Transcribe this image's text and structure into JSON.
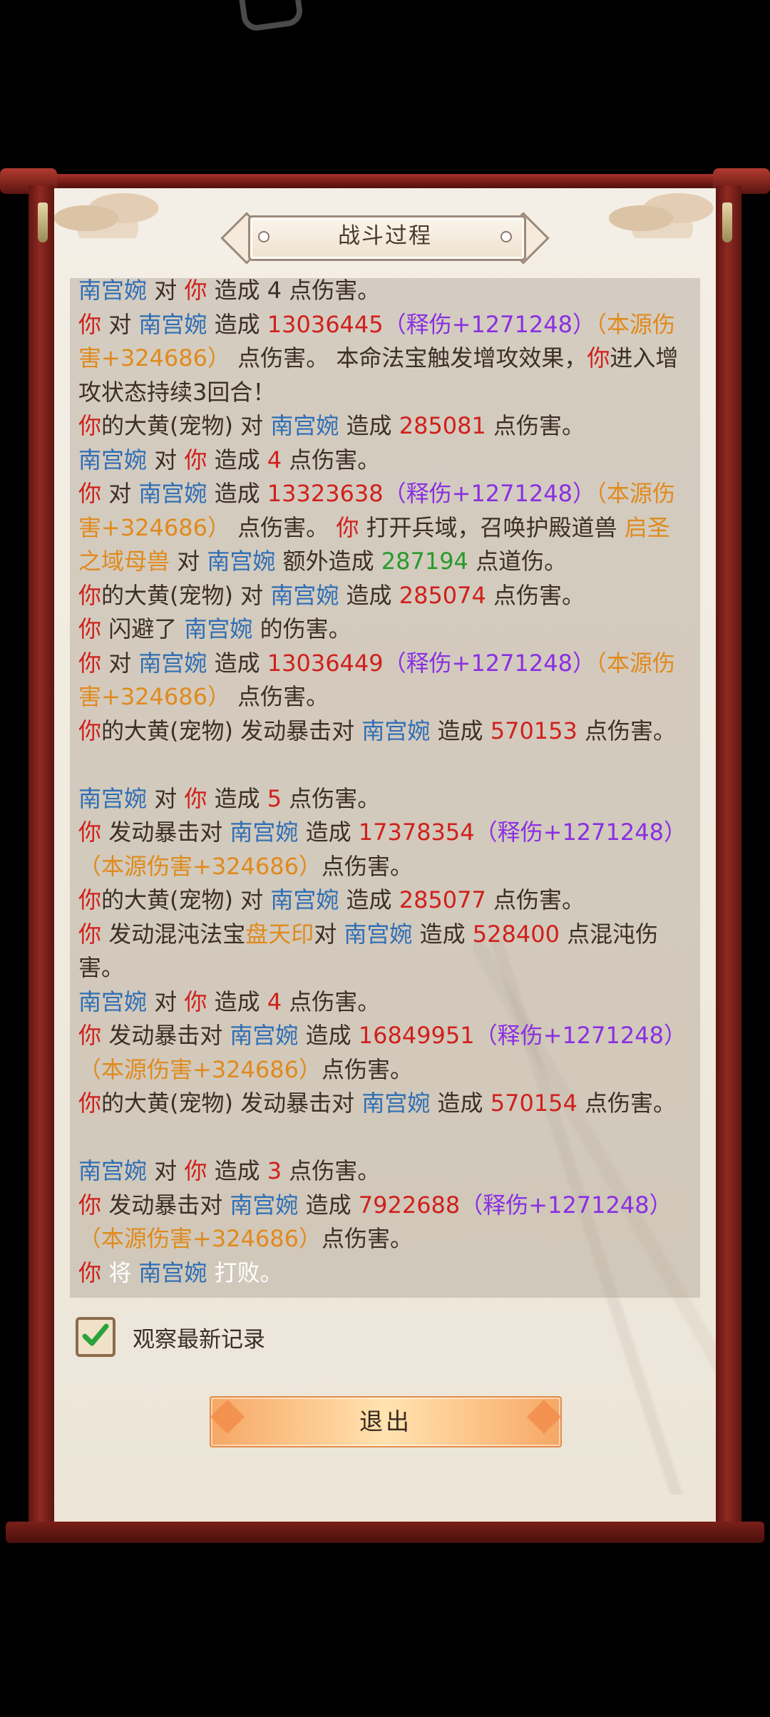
{
  "dialog": {
    "title": "战斗过程",
    "checkbox_label": "观察最新记录",
    "checkbox_checked": true,
    "exit_label": "退出"
  },
  "colors": {
    "player": "#d0201c",
    "enemy": "#2f6eb5",
    "bonus_damage": "#8a2fe2",
    "origin_damage": "#e08a1e",
    "dao_damage": "#279a2b",
    "scroll_frame": "#7a1f19"
  },
  "log": [
    {
      "segments": [
        {
          "t": "南宫婉",
          "c": "b"
        },
        {
          "t": " 对 ",
          "c": ""
        },
        {
          "t": "你",
          "c": "r"
        },
        {
          "t": " 造成 4 点伤害。",
          "c": ""
        }
      ]
    },
    {
      "segments": [
        {
          "t": "你",
          "c": "r"
        },
        {
          "t": " 对 ",
          "c": ""
        },
        {
          "t": "南宫婉",
          "c": "b"
        },
        {
          "t": " 造成 ",
          "c": ""
        },
        {
          "t": "13036445",
          "c": "r"
        },
        {
          "t": "（释伤+1271248）",
          "c": "p"
        },
        {
          "t": "（本源伤害+324686）",
          "c": "o"
        },
        {
          "t": " 点伤害。 本命法宝触发增攻效果，",
          "c": ""
        },
        {
          "t": "你",
          "c": "r"
        },
        {
          "t": "进入增攻状态持续3回合！",
          "c": ""
        }
      ]
    },
    {
      "segments": [
        {
          "t": "你",
          "c": "r"
        },
        {
          "t": "的大黄(宠物) 对 ",
          "c": ""
        },
        {
          "t": "南宫婉",
          "c": "b"
        },
        {
          "t": " 造成 ",
          "c": ""
        },
        {
          "t": "285081",
          "c": "r"
        },
        {
          "t": " 点伤害。",
          "c": ""
        }
      ]
    },
    {
      "segments": [
        {
          "t": "南宫婉",
          "c": "b"
        },
        {
          "t": " 对 ",
          "c": ""
        },
        {
          "t": "你",
          "c": "r"
        },
        {
          "t": " 造成 ",
          "c": ""
        },
        {
          "t": "4",
          "c": "r"
        },
        {
          "t": " 点伤害。",
          "c": ""
        }
      ]
    },
    {
      "segments": [
        {
          "t": "你",
          "c": "r"
        },
        {
          "t": " 对 ",
          "c": ""
        },
        {
          "t": "南宫婉",
          "c": "b"
        },
        {
          "t": " 造成 ",
          "c": ""
        },
        {
          "t": "13323638",
          "c": "r"
        },
        {
          "t": "（释伤+1271248）",
          "c": "p"
        },
        {
          "t": "（本源伤害+324686）",
          "c": "o"
        },
        {
          "t": " 点伤害。 ",
          "c": ""
        },
        {
          "t": "你",
          "c": "r"
        },
        {
          "t": " 打开兵域，召唤护殿道兽 ",
          "c": ""
        },
        {
          "t": "启圣之域母兽",
          "c": "o"
        },
        {
          "t": " 对 ",
          "c": ""
        },
        {
          "t": "南宫婉",
          "c": "b"
        },
        {
          "t": " 额外造成 ",
          "c": ""
        },
        {
          "t": "287194",
          "c": "g"
        },
        {
          "t": " 点道伤。",
          "c": ""
        }
      ]
    },
    {
      "segments": [
        {
          "t": "你",
          "c": "r"
        },
        {
          "t": "的大黄(宠物) 对 ",
          "c": ""
        },
        {
          "t": "南宫婉",
          "c": "b"
        },
        {
          "t": " 造成 ",
          "c": ""
        },
        {
          "t": "285074",
          "c": "r"
        },
        {
          "t": " 点伤害。",
          "c": ""
        }
      ]
    },
    {
      "segments": [
        {
          "t": "你",
          "c": "r"
        },
        {
          "t": " 闪避了 ",
          "c": ""
        },
        {
          "t": "南宫婉",
          "c": "b"
        },
        {
          "t": " 的伤害。",
          "c": ""
        }
      ]
    },
    {
      "segments": [
        {
          "t": "你",
          "c": "r"
        },
        {
          "t": " 对 ",
          "c": ""
        },
        {
          "t": "南宫婉",
          "c": "b"
        },
        {
          "t": " 造成 ",
          "c": ""
        },
        {
          "t": "13036449",
          "c": "r"
        },
        {
          "t": "（释伤+1271248）",
          "c": "p"
        },
        {
          "t": "（本源伤害+324686）",
          "c": "o"
        },
        {
          "t": " 点伤害。",
          "c": ""
        }
      ]
    },
    {
      "segments": [
        {
          "t": "你",
          "c": "r"
        },
        {
          "t": "的大黄(宠物) 发动暴击对 ",
          "c": ""
        },
        {
          "t": "南宫婉",
          "c": "b"
        },
        {
          "t": " 造成 ",
          "c": ""
        },
        {
          "t": "570153",
          "c": "r"
        },
        {
          "t": " 点伤害。",
          "c": ""
        }
      ]
    },
    {
      "gap": true
    },
    {
      "segments": [
        {
          "t": "南宫婉",
          "c": "b"
        },
        {
          "t": " 对 ",
          "c": ""
        },
        {
          "t": "你",
          "c": "r"
        },
        {
          "t": " 造成 ",
          "c": ""
        },
        {
          "t": "5",
          "c": "r"
        },
        {
          "t": " 点伤害。",
          "c": ""
        }
      ]
    },
    {
      "segments": [
        {
          "t": "你",
          "c": "r"
        },
        {
          "t": " 发动暴击对 ",
          "c": ""
        },
        {
          "t": "南宫婉",
          "c": "b"
        },
        {
          "t": " 造成 ",
          "c": ""
        },
        {
          "t": "17378354",
          "c": "r"
        },
        {
          "t": "（释伤+1271248）",
          "c": "p"
        },
        {
          "t": "（本源伤害+324686）",
          "c": "o"
        },
        {
          "t": "点伤害。",
          "c": ""
        }
      ]
    },
    {
      "segments": [
        {
          "t": "你",
          "c": "r"
        },
        {
          "t": "的大黄(宠物) 对 ",
          "c": ""
        },
        {
          "t": "南宫婉",
          "c": "b"
        },
        {
          "t": " 造成 ",
          "c": ""
        },
        {
          "t": "285077",
          "c": "r"
        },
        {
          "t": " 点伤害。",
          "c": ""
        }
      ]
    },
    {
      "segments": [
        {
          "t": "你",
          "c": "r"
        },
        {
          "t": " 发动混沌法宝",
          "c": ""
        },
        {
          "t": "盘天印",
          "c": "o"
        },
        {
          "t": "对 ",
          "c": ""
        },
        {
          "t": "南宫婉",
          "c": "b"
        },
        {
          "t": " 造成 ",
          "c": ""
        },
        {
          "t": "528400",
          "c": "r"
        },
        {
          "t": " 点混沌伤害。",
          "c": ""
        }
      ]
    },
    {
      "segments": [
        {
          "t": "南宫婉",
          "c": "b"
        },
        {
          "t": " 对 ",
          "c": ""
        },
        {
          "t": "你",
          "c": "r"
        },
        {
          "t": " 造成 ",
          "c": ""
        },
        {
          "t": "4",
          "c": "r"
        },
        {
          "t": " 点伤害。",
          "c": ""
        }
      ]
    },
    {
      "segments": [
        {
          "t": "你",
          "c": "r"
        },
        {
          "t": " 发动暴击对 ",
          "c": ""
        },
        {
          "t": "南宫婉",
          "c": "b"
        },
        {
          "t": " 造成 ",
          "c": ""
        },
        {
          "t": "16849951",
          "c": "r"
        },
        {
          "t": "（释伤+1271248）",
          "c": "p"
        },
        {
          "t": "（本源伤害+324686）",
          "c": "o"
        },
        {
          "t": "点伤害。",
          "c": ""
        }
      ]
    },
    {
      "segments": [
        {
          "t": "你",
          "c": "r"
        },
        {
          "t": "的大黄(宠物) 发动暴击对 ",
          "c": ""
        },
        {
          "t": "南宫婉",
          "c": "b"
        },
        {
          "t": " 造成 ",
          "c": ""
        },
        {
          "t": "570154",
          "c": "r"
        },
        {
          "t": " 点伤害。",
          "c": ""
        }
      ]
    },
    {
      "gap": true
    },
    {
      "segments": [
        {
          "t": "南宫婉",
          "c": "b"
        },
        {
          "t": " 对 ",
          "c": ""
        },
        {
          "t": "你",
          "c": "r"
        },
        {
          "t": " 造成 ",
          "c": ""
        },
        {
          "t": "3",
          "c": "r"
        },
        {
          "t": " 点伤害。",
          "c": ""
        }
      ]
    },
    {
      "segments": [
        {
          "t": "你",
          "c": "r"
        },
        {
          "t": " 发动暴击对 ",
          "c": ""
        },
        {
          "t": "南宫婉",
          "c": "b"
        },
        {
          "t": " 造成 ",
          "c": ""
        },
        {
          "t": "7922688",
          "c": "r"
        },
        {
          "t": "（释伤+1271248）",
          "c": "p"
        },
        {
          "t": "（本源伤害+324686）",
          "c": "o"
        },
        {
          "t": "点伤害。",
          "c": ""
        }
      ]
    },
    {
      "segments": [
        {
          "t": "你",
          "c": "r"
        },
        {
          "t": " 将 ",
          "c": "w"
        },
        {
          "t": "南宫婉",
          "c": "b"
        },
        {
          "t": " 打败。",
          "c": "w"
        }
      ]
    }
  ]
}
